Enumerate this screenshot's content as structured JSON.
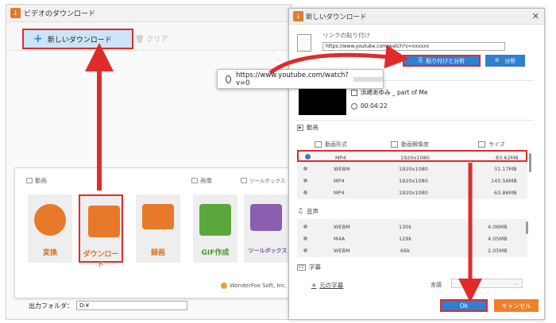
{
  "main_window": {
    "title": "ビデオのダウンロード",
    "new_download_label": "新しいダウンロード",
    "clear_label": "クリア",
    "sections": {
      "video": "動画",
      "image": "画像",
      "toolbox": "ツールボックス"
    },
    "tiles": [
      {
        "label": "変換",
        "color": "#e8792a",
        "label_color": "#d4731f"
      },
      {
        "label": "ダウンロード",
        "color": "#e8792a",
        "label_color": "#d4731f"
      },
      {
        "label": "録画",
        "color": "#e8792a",
        "label_color": "#d4731f"
      },
      {
        "label": "GIF作成",
        "color": "#5aa83b",
        "label_color": "#4a9a2c"
      },
      {
        "label": "ツールボックス",
        "color": "#8a5fb0",
        "label_color": "#7a50a6"
      }
    ],
    "brand": "WonderFox Soft, Inc.",
    "output_folder_label": "出力フォルダ：",
    "output_folder_value": "D:¥"
  },
  "dialog": {
    "title": "新しいダウンロード",
    "paste_link_label": "リンクの貼り付け",
    "url_value": "https://www.youtube.com/watch?v=xxxxxx",
    "paste_analyze_label": "貼り付けと分析",
    "analyze_label": "分析",
    "video_title": "浜崎あゆみ _ part of Me",
    "duration": "00:04:22",
    "video_section": "動画",
    "columns": {
      "format": "動画形式",
      "resolution": "動画解像度",
      "size": "サイズ"
    },
    "video_rows": [
      {
        "format": "MP4",
        "resolution": "1920x1080",
        "size": "83.62MB"
      },
      {
        "format": "WEBM",
        "resolution": "1920x1080",
        "size": "31.17MB"
      },
      {
        "format": "MP4",
        "resolution": "1920x1080",
        "size": "145.56MB"
      },
      {
        "format": "MP4",
        "resolution": "1920x1080",
        "size": "63.86MB"
      }
    ],
    "audio_section": "音声",
    "audio_rows": [
      {
        "format": "WEBM",
        "bitrate": "130k",
        "size": "4.06MB"
      },
      {
        "format": "M4A",
        "bitrate": "129k",
        "size": "4.05MB"
      },
      {
        "format": "WEBM",
        "bitrate": "66k",
        "size": "2.05MB"
      }
    ],
    "subtitle_section": "字幕",
    "original_subtitle": "元の字幕",
    "language_label": "言語",
    "ok_label": "Ok",
    "cancel_label": "キャンセル"
  },
  "callout": {
    "url": "https://www.youtube.com/watch?v=0"
  },
  "colors": {
    "accent": "#2f7fd3",
    "highlight": "#e02b2b",
    "orange": "#e8792a"
  }
}
